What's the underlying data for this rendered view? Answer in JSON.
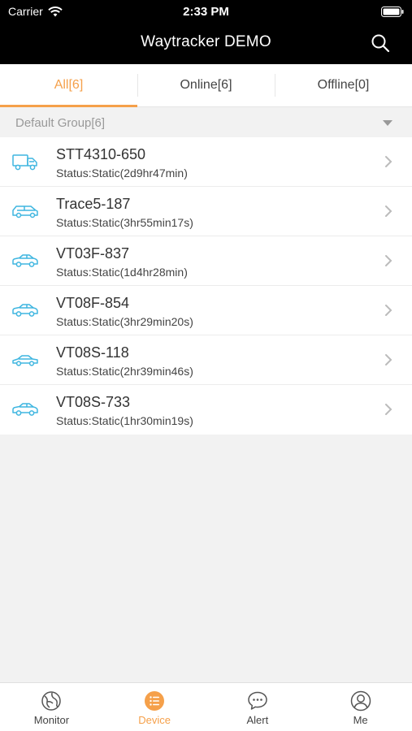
{
  "status_bar": {
    "carrier": "Carrier",
    "time": "2:33 PM"
  },
  "header": {
    "title": "Waytracker DEMO",
    "search_icon": "search-icon"
  },
  "tabs": [
    {
      "label": "All[6]",
      "active": true
    },
    {
      "label": "Online[6]",
      "active": false
    },
    {
      "label": "Offline[0]",
      "active": false
    }
  ],
  "group": {
    "label": "Default Group[6]"
  },
  "devices": [
    {
      "name": "STT4310-650",
      "status": "Status:Static(2d9hr47min)",
      "icon": "truck-icon"
    },
    {
      "name": "Trace5-187",
      "status": "Status:Static(3hr55min17s)",
      "icon": "suv-icon"
    },
    {
      "name": "VT03F-837",
      "status": "Status:Static(1d4hr28min)",
      "icon": "car-icon"
    },
    {
      "name": "VT08F-854",
      "status": "Status:Static(3hr29min20s)",
      "icon": "car-icon"
    },
    {
      "name": "VT08S-118",
      "status": "Status:Static(2hr39min46s)",
      "icon": "sedan-icon"
    },
    {
      "name": "VT08S-733",
      "status": "Status:Static(1hr30min19s)",
      "icon": "car-icon"
    }
  ],
  "tabbar": [
    {
      "label": "Monitor",
      "icon": "globe-icon",
      "active": false
    },
    {
      "label": "Device",
      "icon": "list-icon",
      "active": true
    },
    {
      "label": "Alert",
      "icon": "chat-bubble-icon",
      "active": false
    },
    {
      "label": "Me",
      "icon": "user-icon",
      "active": false
    }
  ],
  "colors": {
    "accent": "#f5a04a",
    "vehicle_icon": "#3fb6e0",
    "header_bg": "#000000"
  }
}
